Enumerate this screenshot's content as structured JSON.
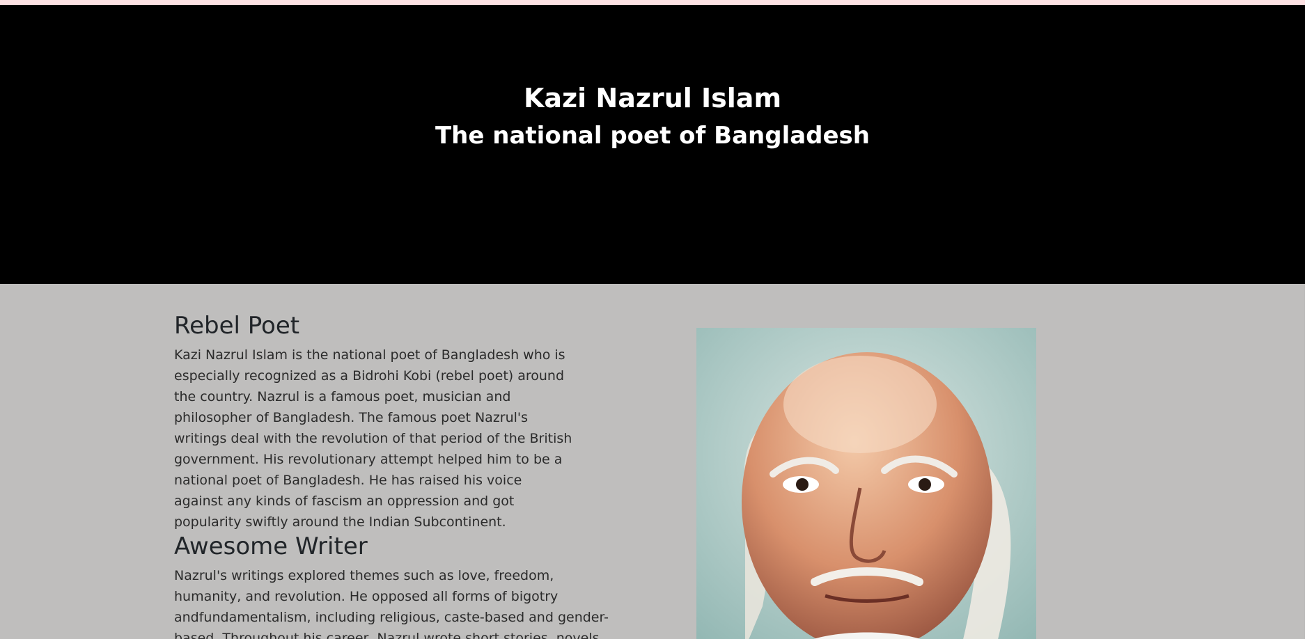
{
  "hero": {
    "title": "Kazi Nazrul Islam",
    "subtitle": "The national poet of Bangladesh"
  },
  "sections": [
    {
      "heading": "Rebel Poet",
      "text": "Kazi Nazrul Islam is the national poet of Bangladesh who is especially recognized as a Bidrohi Kobi (rebel poet) around the country. Nazrul is a famous poet, musician and philosopher of Bangladesh. The famous poet Nazrul's writings deal with the revolution of that period of the British government. His revolutionary attempt helped him to be a national poet of Bangladesh. He has raised his voice against any kinds of fascism an oppression and got popularity swiftly around the Indian Subcontinent."
    },
    {
      "heading": "Awesome Writer",
      "text": "Nazrul's writings explored themes such as love, freedom, humanity, and revolution. He opposed all forms of bigotry andfundamentalism, including religious, caste-based and gender-based. Throughout his career, Nazrul wrote short stories, novels, and"
    }
  ],
  "colors": {
    "top_strip": "#fde2e4",
    "hero_bg": "#000000",
    "main_bg": "#bfbebd"
  }
}
